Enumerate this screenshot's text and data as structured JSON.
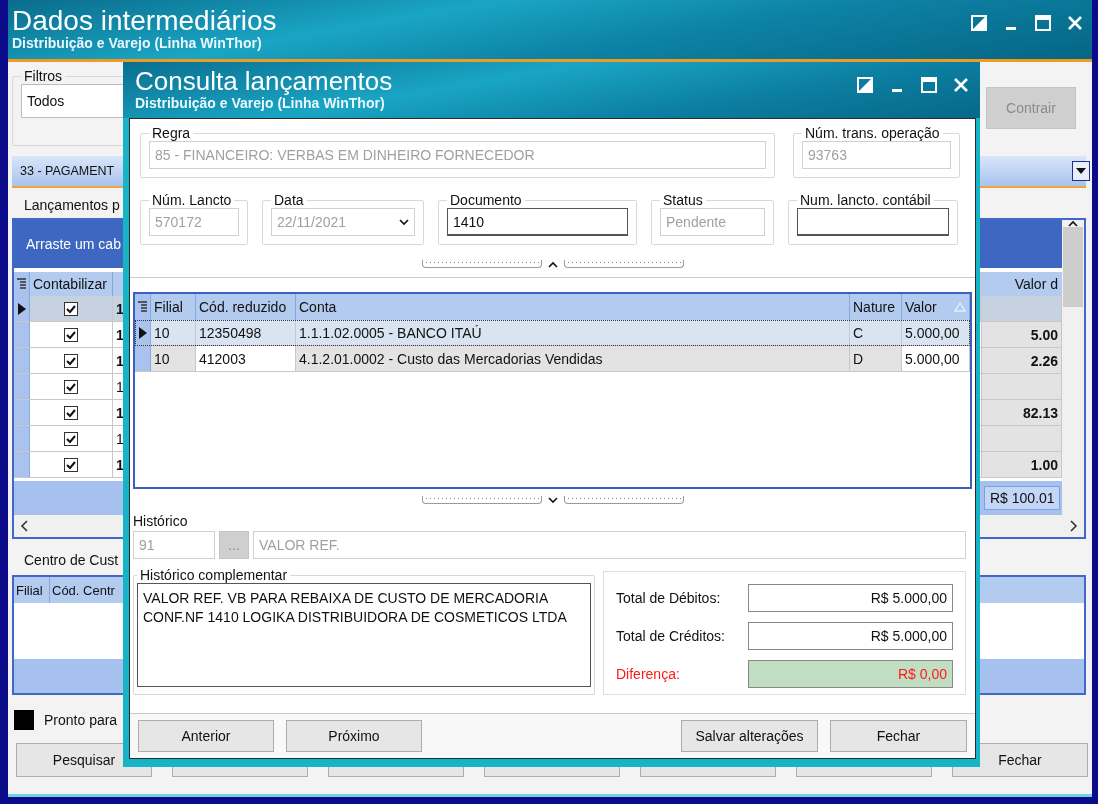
{
  "main_window": {
    "title": "Dados intermediários",
    "subtitle": "Distribuição e Varejo (Linha WinThor)",
    "filters": {
      "label": "Filtros",
      "value": "Todos"
    },
    "collapse_button": {
      "label": "Contrair",
      "disabled": true
    },
    "section_header": "33 - PAGAMENT",
    "entries_label": "Lançamentos p",
    "entries_grid": {
      "group_hint": "Arraste um cab",
      "column_1": "Contabilizar",
      "column_last": "Valor d",
      "rows": [
        {
          "selected": true,
          "checked": true,
          "column_2": "1",
          "emphasized": true
        },
        {
          "selected": false,
          "checked": true,
          "column_2": "1",
          "emphasized": true,
          "value": "5.00"
        },
        {
          "selected": false,
          "checked": true,
          "column_2": "1",
          "emphasized": true,
          "value": "2.26"
        },
        {
          "selected": false,
          "checked": true,
          "column_2": "1",
          "emphasized": false
        },
        {
          "selected": false,
          "checked": true,
          "column_2": "1",
          "emphasized": true,
          "value": "82.13"
        },
        {
          "selected": false,
          "checked": true,
          "column_2": "1",
          "emphasized": false
        },
        {
          "selected": false,
          "checked": true,
          "column_2": "1",
          "emphasized": true,
          "value": "1.00"
        }
      ],
      "footer_total": "R$ 100.01"
    },
    "cost_center": {
      "label": "Centro de Cust",
      "columns": [
        "Filial",
        "Cód. Centr"
      ]
    },
    "legend": {
      "color": "#000000",
      "label": "Pronto para"
    },
    "buttons": [
      {
        "label": "Pesquisar"
      },
      {
        "kind": "blank"
      },
      {
        "kind": "blank"
      },
      {
        "kind": "blank"
      },
      {
        "kind": "blank"
      },
      {
        "kind": "blank"
      },
      {
        "label": "Fechar"
      }
    ]
  },
  "dialog": {
    "title": "Consulta lançamentos",
    "subtitle": "Distribuição e Varejo (Linha WinThor)",
    "rule": {
      "label": "Regra",
      "value": "85 - FINANCEIRO: VERBAS EM DINHEIRO FORNECEDOR",
      "disabled": true
    },
    "transaction": {
      "label": "Núm. trans. operação",
      "value": "93763",
      "disabled": true
    },
    "fields": [
      {
        "label": "Núm. Lancto",
        "value": "570172",
        "kind": "text",
        "disabled": true
      },
      {
        "label": "Data",
        "value": "22/11/2021",
        "kind": "date",
        "disabled": true
      },
      {
        "label": "Documento",
        "value": "1410",
        "kind": "text",
        "disabled": false
      },
      {
        "label": "Status",
        "value": "Pendente",
        "kind": "text",
        "disabled": true
      },
      {
        "label": "Num. lancto. contábil",
        "kind": "text",
        "disabled": false
      }
    ],
    "accounts_grid": {
      "columns": [
        {
          "label": "Filial",
          "readonly": true,
          "sorted": false
        },
        {
          "label": "Cód. reduzido",
          "readonly": false,
          "sorted": false
        },
        {
          "label": "Conta",
          "readonly": true,
          "sorted": false
        },
        {
          "label": "Nature",
          "readonly": true,
          "sorted": false
        },
        {
          "label": "Valor",
          "readonly": false,
          "sorted": true
        }
      ],
      "rows": [
        {
          "selected": true,
          "cells": [
            "10",
            "12350498",
            "1.1.1.02.0005 - BANCO ITAÚ",
            "C",
            "5.000,00"
          ]
        },
        {
          "selected": false,
          "cells": [
            "10",
            "412003",
            "4.1.2.01.0002 - Custo das Mercadorias Vendidas",
            "D",
            "5.000,00"
          ]
        }
      ]
    },
    "history": {
      "label": "Histórico",
      "code": "91",
      "lookup_button": "...",
      "description": "VALOR REF."
    },
    "complement": {
      "label": "Histórico complementar",
      "lines": [
        "VALOR REF. VB PARA REBAIXA DE CUSTO DE MERCADORIA",
        "CONF.NF 1410 LOGIKA DISTRIBUIDORA DE COSMETICOS LTDA"
      ]
    },
    "totals": [
      {
        "label": "Total de Débitos:",
        "value": "R$ 5.000,00",
        "alert": false
      },
      {
        "label": "Total de Créditos:",
        "value": "R$ 5.000,00",
        "alert": false
      },
      {
        "label": "Diferença:",
        "value": "R$ 0,00",
        "alert": true
      }
    ],
    "left_buttons": [
      {
        "label": "Anterior"
      },
      {
        "label": "Próximo"
      }
    ],
    "right_buttons": [
      {
        "label": "Salvar alterações"
      },
      {
        "label": "Fechar"
      }
    ]
  }
}
